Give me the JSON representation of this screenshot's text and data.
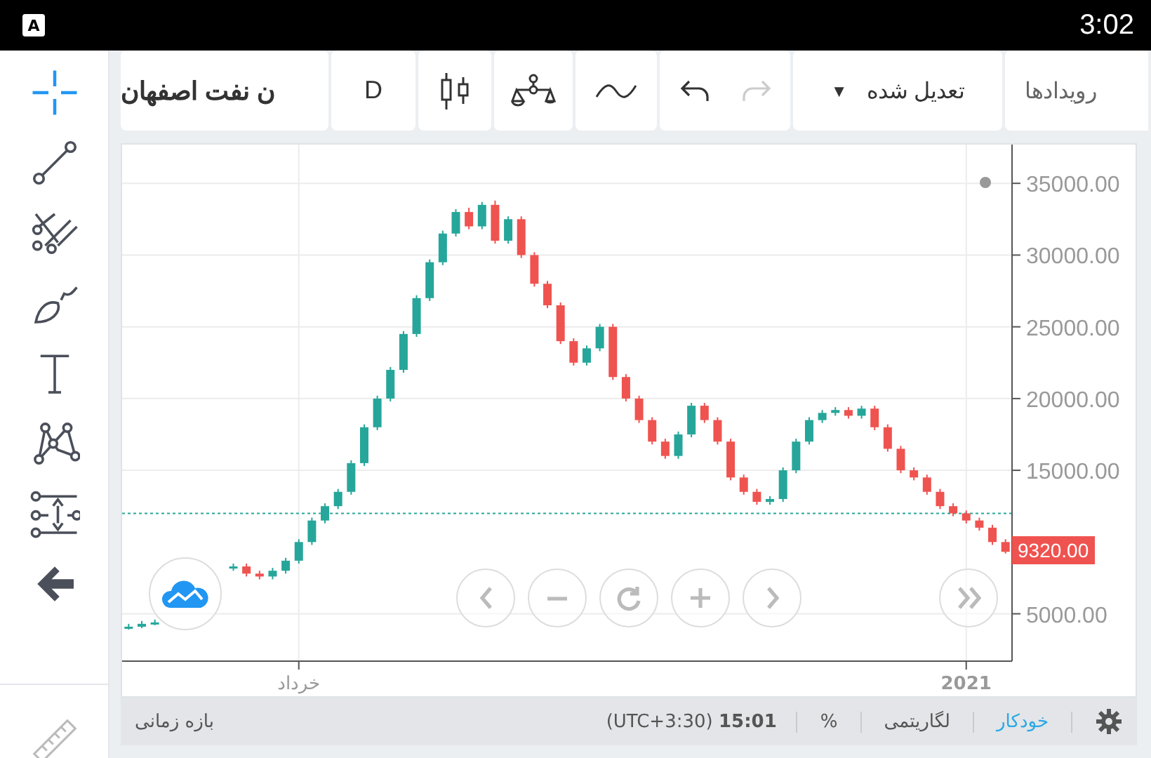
{
  "status_bar": {
    "time": "3:02",
    "app_badge": "A"
  },
  "tools": [
    {
      "kind": "crosshair",
      "selected": true
    },
    {
      "kind": "line",
      "selected": false
    },
    {
      "kind": "fork",
      "selected": false
    },
    {
      "kind": "brush",
      "selected": false
    },
    {
      "kind": "text",
      "selected": false
    },
    {
      "kind": "pattern",
      "selected": false
    },
    {
      "kind": "measure",
      "selected": false
    },
    {
      "kind": "back",
      "selected": false
    }
  ],
  "toolbar": {
    "symbol": "ن نفت اصفهان",
    "interval": "D",
    "adjustment": "تعدیل شده",
    "adjust_caret": "▼",
    "events": "رویدادها"
  },
  "chart": {
    "price_badge": "9320.00",
    "chart_data": {
      "type": "candlestick",
      "grid": true,
      "categories": [
        null,
        null,
        null,
        null,
        null,
        null,
        null,
        null,
        null,
        null,
        null,
        null,
        null,
        "خرداد",
        null,
        null,
        null,
        null,
        null,
        null,
        null,
        null,
        null,
        null,
        null,
        null,
        null,
        null,
        null,
        null,
        null,
        null,
        null,
        null,
        null,
        null,
        null,
        null,
        null,
        null,
        null,
        null,
        null,
        null,
        null,
        null,
        null,
        null,
        null,
        null,
        null,
        null,
        null,
        null,
        null,
        null,
        null,
        null,
        null,
        null,
        null,
        null,
        null,
        null,
        "2021",
        null,
        null,
        null
      ],
      "ohlc": [
        [
          4000,
          4300,
          3900,
          4100
        ],
        [
          4100,
          4500,
          4000,
          4300
        ],
        [
          4300,
          4600,
          4200,
          4400
        ],
        null,
        null,
        null,
        null,
        null,
        [
          8200,
          8500,
          8000,
          8300
        ],
        [
          8300,
          8500,
          7600,
          7800
        ],
        [
          7800,
          8000,
          7400,
          7600
        ],
        [
          7600,
          8200,
          7400,
          8000
        ],
        [
          8000,
          8900,
          7800,
          8700
        ],
        [
          8700,
          10200,
          8500,
          10000
        ],
        [
          10000,
          11700,
          9800,
          11500
        ],
        [
          11500,
          12700,
          11300,
          12500
        ],
        [
          12500,
          13700,
          12300,
          13500
        ],
        [
          13500,
          15700,
          13300,
          15500
        ],
        [
          15500,
          18200,
          15300,
          18000
        ],
        [
          18000,
          20200,
          17800,
          20000
        ],
        [
          20000,
          22200,
          19800,
          22000
        ],
        [
          22000,
          24700,
          21800,
          24500
        ],
        [
          24500,
          27200,
          24300,
          27000
        ],
        [
          27000,
          29700,
          26800,
          29500
        ],
        [
          29500,
          31700,
          29300,
          31500
        ],
        [
          31500,
          33200,
          31300,
          33000
        ],
        [
          33000,
          33300,
          31800,
          32000
        ],
        [
          32000,
          33700,
          31800,
          33500
        ],
        [
          33500,
          33800,
          30800,
          31000
        ],
        [
          31000,
          32700,
          30800,
          32500
        ],
        [
          32500,
          32700,
          29800,
          30000
        ],
        [
          30000,
          30200,
          27800,
          28000
        ],
        [
          28000,
          28200,
          26300,
          26500
        ],
        [
          26500,
          26700,
          23800,
          24000
        ],
        [
          24000,
          24200,
          22300,
          22500
        ],
        [
          22500,
          23700,
          22300,
          23500
        ],
        [
          23500,
          25200,
          23300,
          25000
        ],
        [
          25000,
          25200,
          21300,
          21500
        ],
        [
          21500,
          21700,
          19800,
          20000
        ],
        [
          20000,
          20200,
          18300,
          18500
        ],
        [
          18500,
          18700,
          16800,
          17000
        ],
        [
          17000,
          17200,
          15800,
          16000
        ],
        [
          16000,
          17700,
          15800,
          17500
        ],
        [
          17500,
          19700,
          17300,
          19500
        ],
        [
          19500,
          19700,
          18300,
          18500
        ],
        [
          18500,
          18700,
          16800,
          17000
        ],
        [
          17000,
          17200,
          14300,
          14500
        ],
        [
          14500,
          14700,
          13300,
          13500
        ],
        [
          13500,
          13700,
          12600,
          12800
        ],
        [
          12800,
          13200,
          12600,
          13000
        ],
        [
          13000,
          15200,
          12800,
          15000
        ],
        [
          15000,
          17200,
          14800,
          17000
        ],
        [
          17000,
          18700,
          16800,
          18500
        ],
        [
          18500,
          19200,
          18300,
          19000
        ],
        [
          19000,
          19400,
          18800,
          19200
        ],
        [
          19200,
          19400,
          18600,
          18800
        ],
        [
          18800,
          19500,
          18600,
          19300
        ],
        [
          19300,
          19500,
          17800,
          18000
        ],
        [
          18000,
          18200,
          16300,
          16500
        ],
        [
          16500,
          16700,
          14800,
          15000
        ],
        [
          15000,
          15200,
          14300,
          14500
        ],
        [
          14500,
          14700,
          13300,
          13500
        ],
        [
          13500,
          13700,
          12300,
          12500
        ],
        [
          12500,
          12700,
          11800,
          12000
        ],
        [
          12000,
          12200,
          11300,
          11500
        ],
        [
          11500,
          11700,
          10800,
          11000
        ],
        [
          11000,
          11200,
          9800,
          10000
        ],
        [
          10000,
          10200,
          9200,
          9320
        ]
      ],
      "ylim": [
        1700,
        37700
      ],
      "yticks": [
        {
          "value": 5000,
          "label": "5000.00"
        },
        {
          "value": 15000,
          "label": "15000.00"
        },
        {
          "value": 20000,
          "label": "20000.00"
        },
        {
          "value": 25000,
          "label": "25000.00"
        },
        {
          "value": 30000,
          "label": "30000.00"
        },
        {
          "value": 35000,
          "label": "35000.00"
        }
      ],
      "ref_lines": [
        {
          "axis": "y",
          "value": 12000,
          "color": "#26a69a",
          "line_style": "dotted"
        }
      ]
    }
  },
  "bottom_bar": {
    "range_label": "بازه زمانی",
    "time": "15:01",
    "timezone": "(UTC+3:30)",
    "toggles": [
      {
        "label": "خودکار",
        "on": true
      },
      {
        "label": "لگاریتمی",
        "on": false
      },
      {
        "label": "%",
        "on": false
      }
    ]
  }
}
